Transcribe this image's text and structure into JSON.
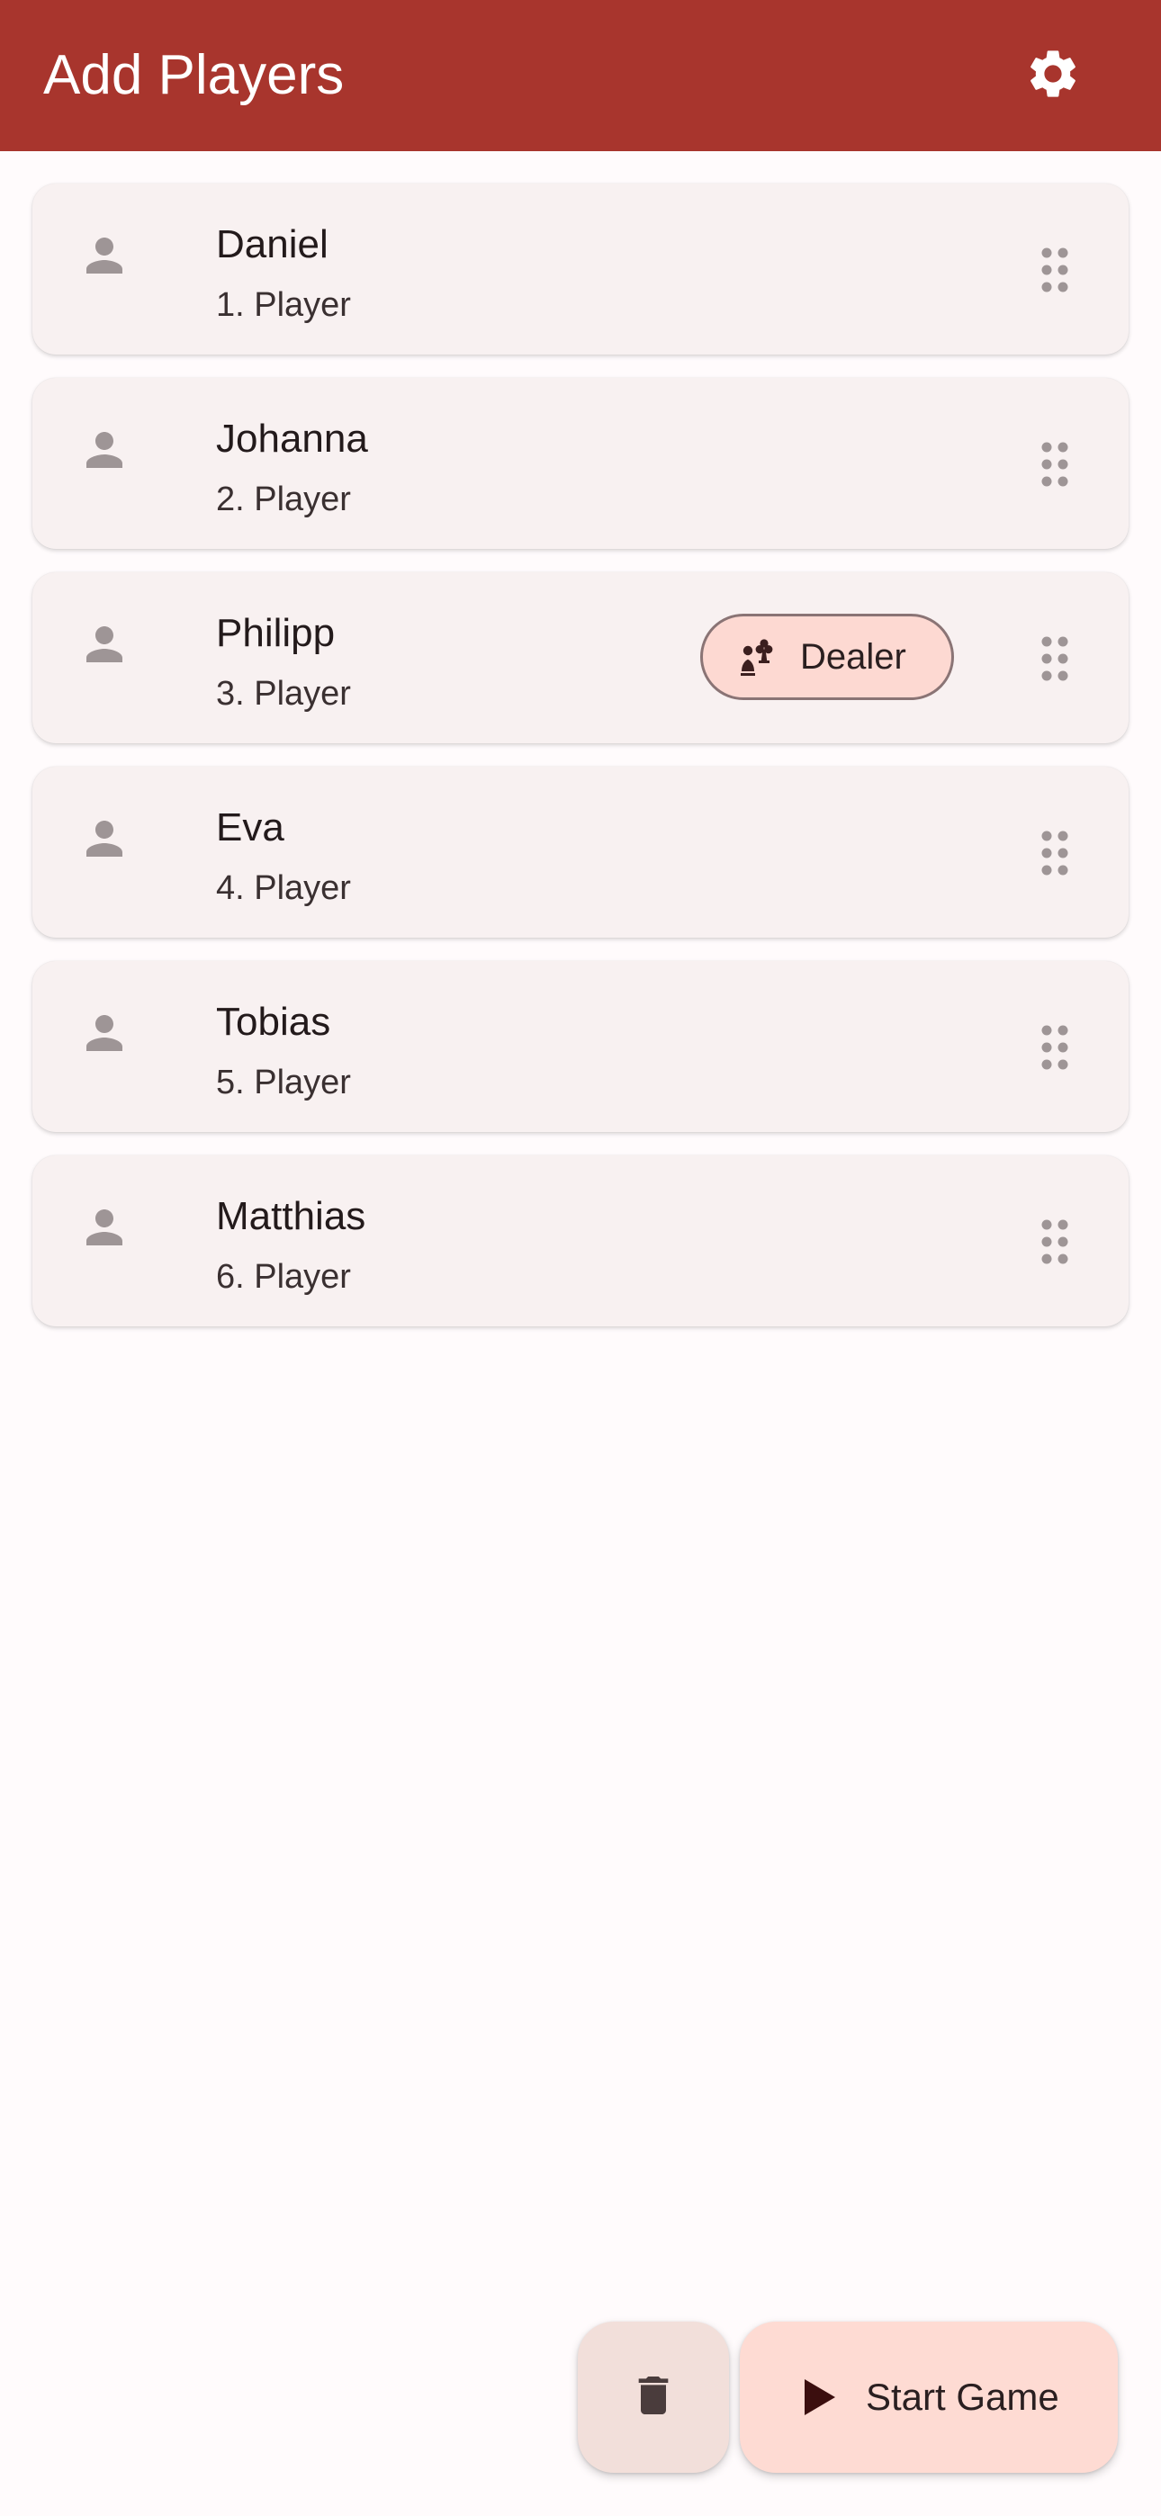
{
  "app_bar": {
    "title": "Add Players",
    "background": "#a8352d",
    "settings_icon": "gear-icon"
  },
  "players": [
    {
      "name": "Daniel",
      "position": "1. Player",
      "dealer": false
    },
    {
      "name": "Johanna",
      "position": "2. Player",
      "dealer": false
    },
    {
      "name": "Philipp",
      "position": "3. Player",
      "dealer": true
    },
    {
      "name": "Eva",
      "position": "4. Player",
      "dealer": false
    },
    {
      "name": "Tobias",
      "position": "5. Player",
      "dealer": false
    },
    {
      "name": "Matthias",
      "position": "6. Player",
      "dealer": false
    }
  ],
  "dealer_chip": {
    "label": "Dealer",
    "icon": "dealer-pieces-icon",
    "background": "#fdd9d2"
  },
  "fabs": {
    "delete_icon": "trash-icon",
    "start_label": "Start Game",
    "start_icon": "play-icon",
    "start_background": "#fedbd3"
  }
}
